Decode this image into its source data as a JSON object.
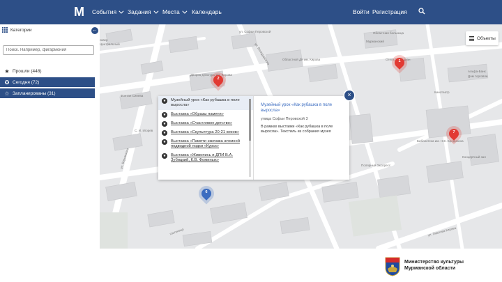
{
  "nav": {
    "logo": "M",
    "items": [
      {
        "label": "События",
        "has_caret": true
      },
      {
        "label": "Задания",
        "has_caret": true
      },
      {
        "label": "Места",
        "has_caret": true
      },
      {
        "label": "Календарь",
        "has_caret": false
      }
    ],
    "login": "Войти",
    "register": "Регистрация",
    "search_icon": "search-icon"
  },
  "sidebar": {
    "title": "Категории",
    "search_placeholder": "Поиск. Например, фигармония",
    "filters": [
      {
        "label": "Прошли (448)",
        "icon": "star-filled-icon"
      },
      {
        "label": "Сегодня (72)",
        "icon": "star-badge-icon"
      },
      {
        "label": "Запланированы (31)",
        "icon": "star-outline-icon"
      }
    ]
  },
  "map": {
    "objects_button": "Объекты",
    "pins": [
      {
        "number": "2",
        "color": "red"
      },
      {
        "number": "1",
        "color": "red"
      },
      {
        "number": "7",
        "color": "red"
      },
      {
        "number": "6",
        "color": "blue"
      }
    ],
    "labels": {
      "l1": "сквер",
      "l2": "Центральный",
      "l3": "ул. Софьи Перовской",
      "l4": "Дворец культуры им. Кирова",
      "l5": "Областной ДК им. Кирова",
      "l6": "Областная больница",
      "l7": "Мурманский",
      "l8": "Отель Меридиан",
      "l9": "Альфа-Банк",
      "l10": "Дом торговли",
      "l11": "ул. Володарского",
      "l12": "ул. Воровского",
      "l13": "Библиотека им. Н.Е. Бредихина",
      "l14": "Концертный зал",
      "l15": "ул. Павлова Кирова",
      "l16": "Фонтан Синева",
      "l17": "С. И. Игорев",
      "l18": "гостиница",
      "l19": "Кинотеатр",
      "l20": "Полярный Экспресс"
    }
  },
  "popup": {
    "items": [
      "Музейный урок «Как рубашка в поле выросла»",
      "Выставка «Образы памяти»",
      "Выставка «Счастливое детство»",
      "Выставка «Скульптура 20-21 веков»",
      "Выставка «Памяти экипажа атомной подводной лодки «Курск»",
      "Выставка «Живопись и ДПИ В.А. Зубицкий, К.В. Фоминых»"
    ],
    "detail_title": "Музейный урок «Как рубашка в поле выросла»",
    "detail_address": "улица Софьи Перовской 3",
    "detail_desc": "В рамках выставки «Как рубашка в поле выросла». Текстиль из собрания музея"
  },
  "footer": {
    "line1": "Министерство культуры",
    "line2": "Мурманской области"
  },
  "colors": {
    "primary": "#2d4f87",
    "pin_red": "#e23a33",
    "pin_blue": "#3b6cc0"
  }
}
